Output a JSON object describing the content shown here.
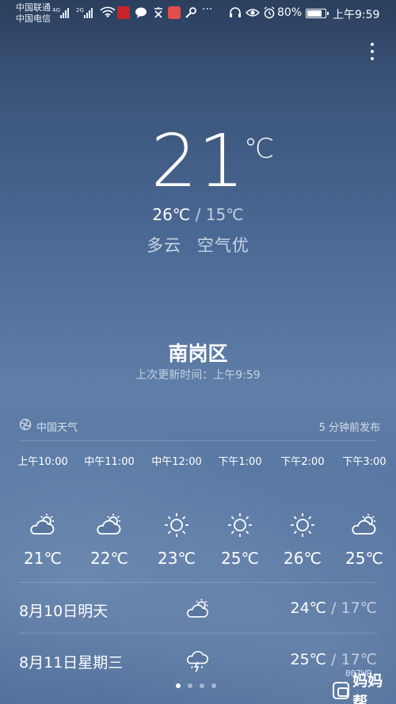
{
  "status_bar": {
    "carrier_1": "中国联通",
    "carrier_2": "中国电信",
    "net_1": "4G",
    "net_2": "2G",
    "battery": "80%",
    "time": "上午9:59"
  },
  "current": {
    "temp": "21",
    "unit": "℃",
    "high": "26℃",
    "separator": " / ",
    "low": "15℃",
    "condition": "多云",
    "air_quality": "空气优"
  },
  "location": {
    "city": "南岗区",
    "updated": "上次更新时间：上午9:59"
  },
  "source": {
    "name": "中国天气",
    "published": "5 分钟前发布"
  },
  "hourly": [
    {
      "time": "上午10:00",
      "icon": "partly-cloudy-icon",
      "temp": "21℃"
    },
    {
      "time": "中午11:00",
      "icon": "partly-cloudy-icon",
      "temp": "22℃"
    },
    {
      "time": "中午12:00",
      "icon": "sunny-icon",
      "temp": "23℃"
    },
    {
      "time": "下午1:00",
      "icon": "sunny-icon",
      "temp": "25℃"
    },
    {
      "time": "下午2:00",
      "icon": "sunny-icon",
      "temp": "26℃"
    },
    {
      "time": "下午3:00",
      "icon": "partly-cloudy-icon",
      "temp": "25℃"
    }
  ],
  "daily": [
    {
      "date": "8月10日明天",
      "icon": "partly-cloudy-icon",
      "high": "24℃",
      "sep": " / ",
      "low": "17℃"
    },
    {
      "date": "8月11日星期三",
      "icon": "thunderstorm-icon",
      "high": "25℃",
      "sep": " / ",
      "low": "17℃"
    }
  ],
  "pager": {
    "pages": 4,
    "active": 1
  },
  "watermark": {
    "code": "007WP",
    "brand": "妈妈帮"
  },
  "colors": {
    "background_top": "#2b3f5e",
    "background_bottom": "#4e6d99",
    "text": "#ffffff",
    "muted_text": "#c3cfe0"
  }
}
